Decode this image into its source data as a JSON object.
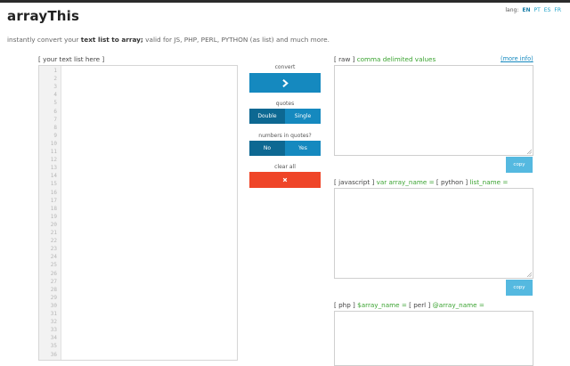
{
  "app": {
    "title": "arrayThis"
  },
  "lang": {
    "label": "lang:",
    "options": [
      {
        "code": "EN",
        "active": true
      },
      {
        "code": "PT",
        "active": false
      },
      {
        "code": "ES",
        "active": false
      },
      {
        "code": "FR",
        "active": false
      }
    ]
  },
  "tagline": {
    "prefix": "instantly convert your ",
    "strong": "text list to array;",
    "suffix": " valid for JS, PHP, PERL, PYTHON (as list) and much more."
  },
  "input": {
    "label": "[ your text list here ]",
    "line_numbers": [
      "1",
      "2",
      "3",
      "4",
      "5",
      "6",
      "7",
      "8",
      "9",
      "10",
      "11",
      "12",
      "13",
      "14",
      "15",
      "16",
      "17",
      "18",
      "19",
      "20",
      "21",
      "22",
      "23",
      "24",
      "25",
      "26",
      "27",
      "28",
      "29",
      "30",
      "31",
      "32",
      "33",
      "34",
      "35",
      "36"
    ]
  },
  "controls": {
    "convert_label": "convert",
    "convert_icon": "chevron-right-icon",
    "quotes_label": "quotes",
    "quotes_options": [
      "Double",
      "Single"
    ],
    "quotes_selected": "Double",
    "numbers_label": "numbers in quotes?",
    "numbers_options": [
      "No",
      "Yes"
    ],
    "numbers_selected": "No",
    "clear_label": "clear all",
    "clear_icon": "close-icon"
  },
  "outputs": {
    "raw": {
      "tag": "[ raw ]",
      "desc": " comma delimited values",
      "more": "(more info)",
      "copy": "copy"
    },
    "js": {
      "tag1": "[ javascript ]",
      "desc1": " var array_name = ",
      "tag2": "[ python ]",
      "desc2": " list_name =",
      "copy": "copy"
    },
    "php": {
      "tag1": "[ php ]",
      "desc1": " $array_name = ",
      "tag2": "[ perl ]",
      "desc2": " @array_name ="
    }
  },
  "colors": {
    "accent": "#1589bf",
    "accent_dark": "#0d6892",
    "danger": "#ef4528",
    "copy": "#55b9e0",
    "green": "#3aa330"
  }
}
